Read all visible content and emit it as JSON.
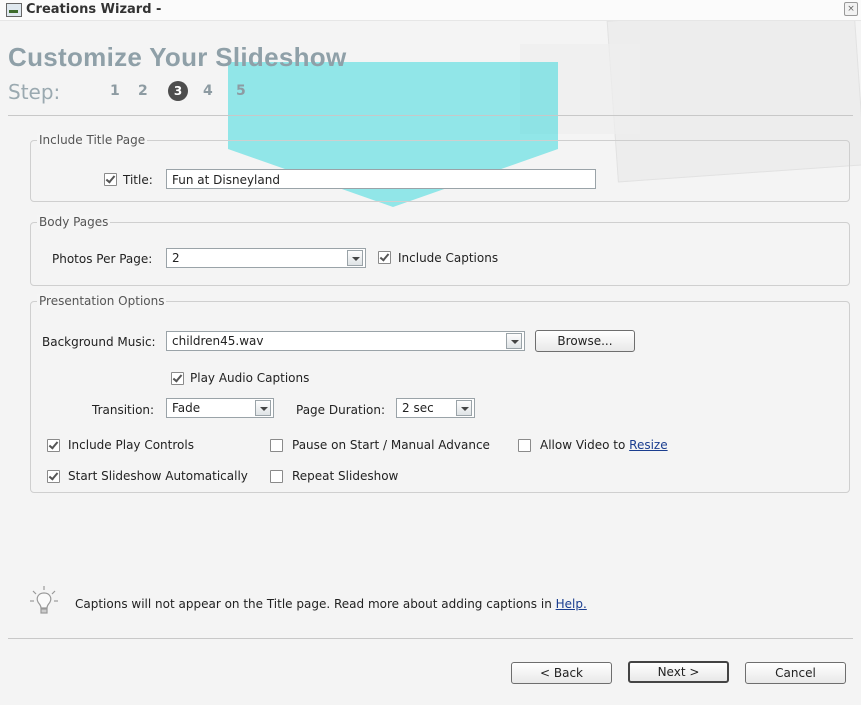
{
  "window": {
    "title": "Creations Wizard -",
    "close_glyph": "×"
  },
  "header": {
    "title": "Customize Your Slideshow",
    "step_label": "Step:",
    "steps": [
      "1",
      "2",
      "3",
      "4",
      "5"
    ],
    "current_step": "3"
  },
  "title_page": {
    "legend": "Include Title Page",
    "title_label": "Title:",
    "title_value": "Fun at Disneyland",
    "include_checked": true
  },
  "body_pages": {
    "legend": "Body Pages",
    "photos_label": "Photos Per Page:",
    "photos_value": "2",
    "captions_label": "Include Captions",
    "captions_checked": true
  },
  "presentation": {
    "legend": "Presentation Options",
    "music_label": "Background Music:",
    "music_value": "children45.wav",
    "browse_label": "Browse...",
    "play_audio_label": "Play Audio Captions",
    "play_audio_checked": true,
    "transition_label": "Transition:",
    "transition_value": "Fade",
    "page_duration_label": "Page Duration:",
    "page_duration_value": "2 sec",
    "include_controls_label": "Include Play Controls",
    "include_controls_checked": true,
    "pause_label": "Pause on Start / Manual Advance",
    "pause_checked": false,
    "allow_video_label": "Allow Video to ",
    "allow_video_link": "Resize",
    "allow_video_checked": false,
    "start_auto_label": "Start Slideshow Automatically",
    "start_auto_checked": true,
    "repeat_label": "Repeat Slideshow",
    "repeat_checked": false
  },
  "hint": {
    "text": "Captions will not appear on the Title page. Read more about adding captions in ",
    "link": "Help."
  },
  "footer": {
    "back_label": "< Back",
    "next_label": "Next >",
    "cancel_label": "Cancel"
  },
  "colors": {
    "accent_banner": "#08d2d7",
    "header_text": "#8fa0a8"
  }
}
